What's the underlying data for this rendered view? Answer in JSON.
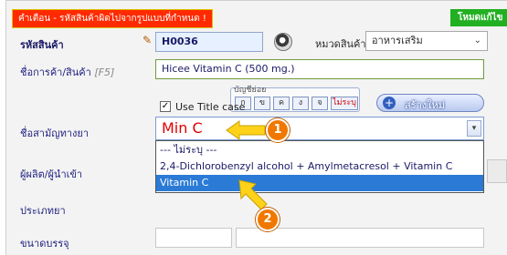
{
  "warning": "คำเตือน - รหัสสินค้าผิดไปจากรูปแบบที่กำหนด !",
  "mode": "โหมดแก้ไข",
  "labels": {
    "product_code": "รหัสสินค้า",
    "trade_name": "ชื่อการค้า/สินค้า",
    "trade_name_hint": "[F5]",
    "generic_name": "ชื่อสามัญทางยา",
    "manufacturer": "ผู้ผลิต/ผู้นำเข้า",
    "drug_type": "ประเภทยา",
    "package_size": "ขนาดบรรจุ"
  },
  "product_code": "H0036",
  "category": {
    "label": "หมวดสินค้า",
    "value": "อาหารเสริม"
  },
  "trade_name": "Hicee Vitamin C (500 mg.)",
  "use_title_case": {
    "label": "Use Title case",
    "checked": true,
    "mark": "✓"
  },
  "sub_account": {
    "legend": "บัญชีย่อย",
    "buttons": [
      "ก",
      "ข",
      "ค",
      "ง",
      "จ"
    ],
    "none": "ไม่ระบุ"
  },
  "create_new": "สร้างใหม่",
  "generic_name_value": "Min C",
  "dropdown_options": [
    "--- ไม่ระบุ ---",
    "2,4-Dichlorobenzyl alcohol + Amylmetacresol + Vitamin C",
    "Vitamin C"
  ],
  "selected_option": 2,
  "callouts": [
    "1",
    "2"
  ],
  "colors": {
    "warning_bg": "#ff2a00",
    "mode_bg": "#21b021",
    "highlight": "#2a7ad6",
    "arrow": "#ffd21a",
    "badge": "#f07800"
  }
}
